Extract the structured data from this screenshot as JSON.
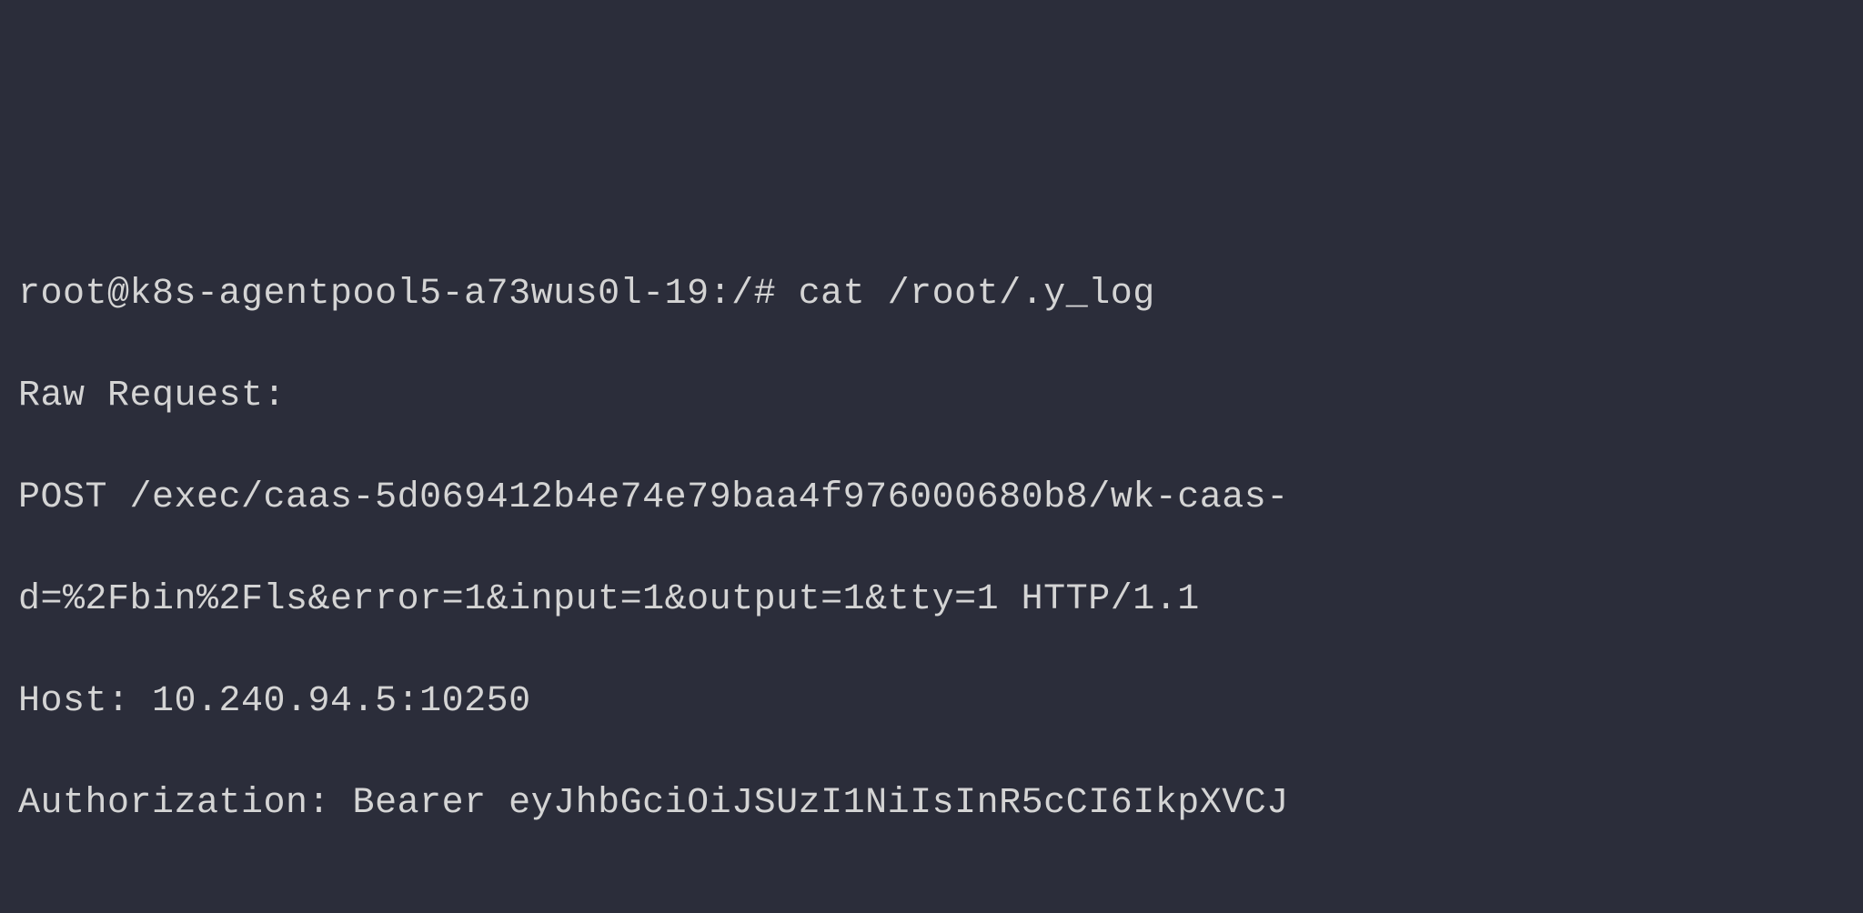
{
  "terminal": {
    "prompt": "root@k8s-agentpool5-a73wus0l-19:/#",
    "command": "cat /root/.y_log",
    "output": {
      "line1": "Raw Request:",
      "line2": "POST /exec/caas-5d069412b4e74e79baa4f976000680b8/wk-caas-",
      "line3": "d=%2Fbin%2Fls&error=1&input=1&output=1&tty=1 HTTP/1.1",
      "line4": "Host: 10.240.94.5:10250",
      "line5": "Authorization: Bearer eyJhbGciOiJSUzI1NiIsInR5cCI6IkpXVCJ"
    }
  }
}
